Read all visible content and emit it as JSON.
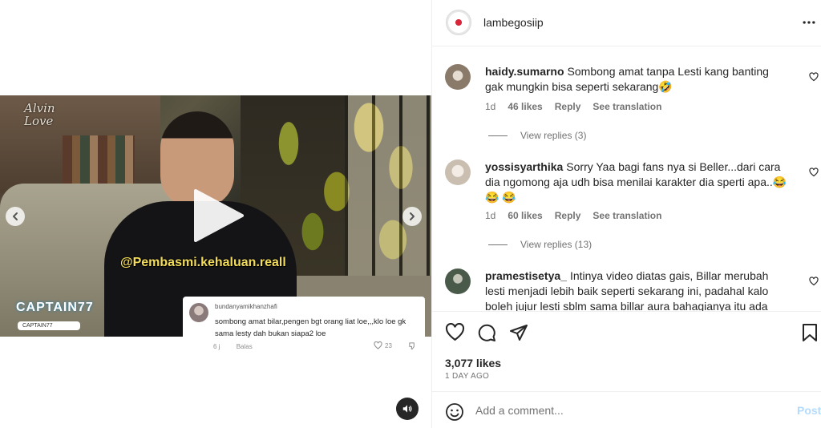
{
  "post": {
    "username": "lambegosiip",
    "likes": "3,077 likes",
    "time_ago": "1 DAY AGO"
  },
  "video": {
    "logo_line1": "Alvin",
    "logo_line2": "Love",
    "handle_overlay": "@Pembasmi.kehaluan.reall",
    "brand_overlay": "CAPTAIN77",
    "brand_sub": "CAPTAIN77",
    "overlay_comment": {
      "username": "bundanyamikhanzhafi",
      "text": "sombong amat bilar,pengen bgt orang liat loe,,,klo loe gk sama lesty dah bukan siapa2 loe",
      "age": "6 j",
      "reply": "Balas",
      "likes": "23"
    }
  },
  "comments": [
    {
      "username": "haidy.sumarno",
      "text": "Sombong amat tanpa Lesti kang banting gak mungkin bisa seperti sekarang🤣",
      "age": "1d",
      "likes": "46 likes",
      "reply": "Reply",
      "translate": "See translation",
      "view_replies": "View replies (3)",
      "avatar_color": "#8a7a6a"
    },
    {
      "username": "yossisyarthika",
      "text": "Sorry Yaa bagi fans nya si Beller...dari cara dia ngomong aja udh bisa menilai karakter dia sperti apa..😂 😂 😂",
      "age": "1d",
      "likes": "60 likes",
      "reply": "Reply",
      "translate": "See translation",
      "view_replies": "View replies (13)",
      "avatar_color": "#c9beb0"
    },
    {
      "username": "pramestisetya_",
      "text": "Intinya video diatas gais, Billar merubah lesti menjadi lebih baik seperti sekarang ini, padahal kalo boleh jujur lesti sblm sama billar aura bahagianya itu ada terus, skrng",
      "avatar_color": "#4a5a4a"
    }
  ],
  "add_comment": {
    "placeholder": "Add a comment...",
    "post_label": "Post"
  },
  "colors": {
    "text": "#262626",
    "muted": "#737373",
    "border": "#efefef",
    "post_disabled": "#b3dbff"
  }
}
